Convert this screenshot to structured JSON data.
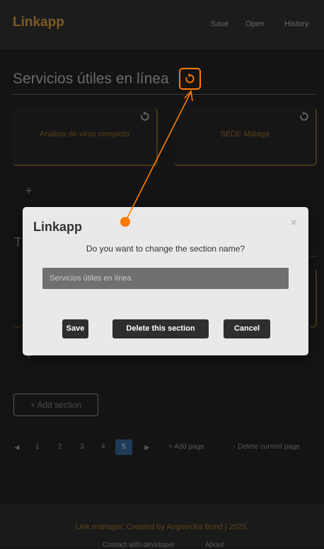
{
  "nav": {
    "brand": "Linkapp",
    "save": "Save",
    "open": "Open",
    "history": "History"
  },
  "section": {
    "title": "Servicios útiles en línea",
    "cards": [
      {
        "label": "Análisis de virus completo"
      },
      {
        "label": "SEDE Málaga"
      }
    ],
    "add_link": "+",
    "hidden_title": "T",
    "add_link_2": "+"
  },
  "add_section": "+ Add section",
  "pager": {
    "prev": "◄",
    "pages": [
      "1",
      "2",
      "3",
      "4",
      "5"
    ],
    "next": "►",
    "add_page": "+ Add page",
    "delete_page": "- Delete current page"
  },
  "footer": {
    "credit": "Link manager. Created by Angevicka Bond | 2025.",
    "contact": "Contact with developer",
    "about": "About"
  },
  "modal": {
    "title": "Linkapp",
    "close": "×",
    "question": "Do you want to change the section name?",
    "input_value": "Servicios útiles en línea",
    "save": "Save",
    "delete": "Delete this section",
    "cancel": "Cancel"
  },
  "colors": {
    "accent": "#ff7a00",
    "brand": "#7d5a22",
    "active_page": "#1f3a57"
  }
}
